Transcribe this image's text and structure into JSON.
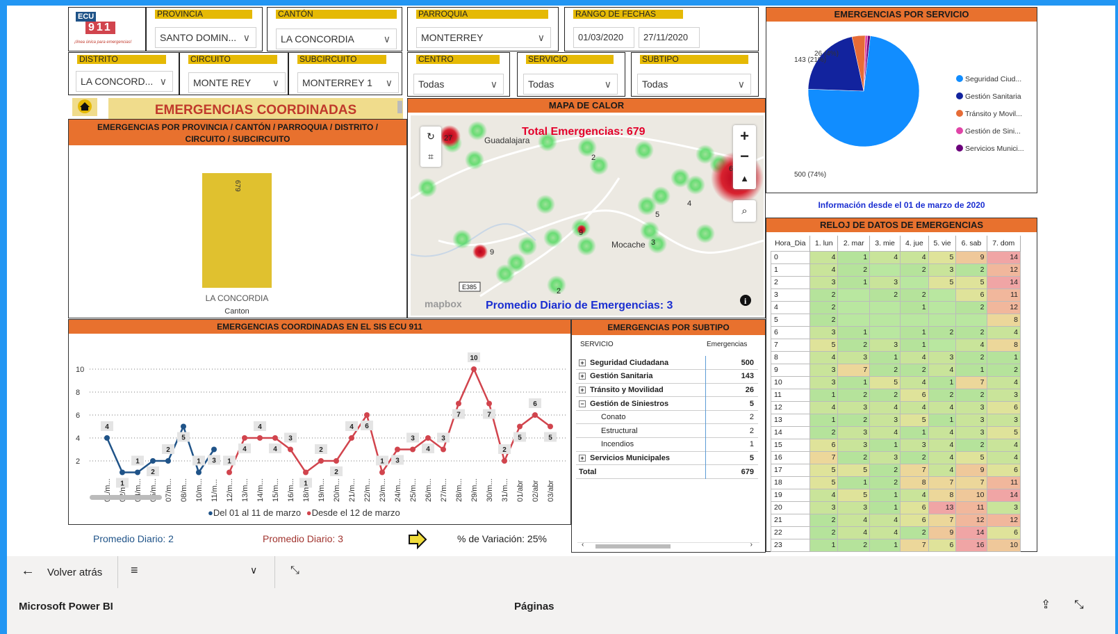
{
  "logo": {
    "main": "ECU",
    "number": "911",
    "tag": "¡línea única para emergencias!"
  },
  "slicers": {
    "provincia": {
      "label": "PROVINCIA",
      "value": "SANTO DOMIN..."
    },
    "canton": {
      "label": "CANTÓN",
      "value": "LA CONCORDIA"
    },
    "parroquia": {
      "label": "PARROQUIA",
      "value": "MONTERREY"
    },
    "rango": {
      "label": "RANGO DE FECHAS",
      "from": "01/03/2020",
      "to": "27/11/2020"
    },
    "distrito": {
      "label": "DISTRITO",
      "value": "LA CONCORD..."
    },
    "circuito": {
      "label": "CIRCUITO",
      "value": "MONTE REY"
    },
    "subcircuito": {
      "label": "SUBCIRCUITO",
      "value": "MONTERREY 1"
    },
    "centro": {
      "label": "CENTRO",
      "value": "Todas"
    },
    "servicio": {
      "label": "SERVICIO",
      "value": "Todas"
    },
    "subtipo": {
      "label": "SUBTIPO",
      "value": "Todas"
    }
  },
  "page_title": "EMERGENCIAS COORDINADAS",
  "bar_panel": {
    "title": "EMERGENCIAS POR PROVINCIA / CANTÓN / PARROQUIA / DISTRITO / CIRCUITO / SUBCIRCUITO",
    "xlabel": "Canton"
  },
  "map": {
    "title": "MAPA DE CALOR",
    "total": "Total Emergencias: 679",
    "avg": "Promedio Diario de Emergencias: 3",
    "places": [
      "Guadalajara",
      "Mocache"
    ],
    "road": "E385",
    "brand": "mapbox",
    "cluster_labels": [
      "27",
      "2",
      "4",
      "5",
      "9",
      "9",
      "3",
      "2",
      "6"
    ]
  },
  "service_panel": {
    "title": "EMERGENCIAS POR SERVICIO",
    "info": "Información desde el 01 de marzo de 2020"
  },
  "line_panel": {
    "title": "EMERGENCIAS COORDINADAS EN EL SIS ECU 911",
    "legend": [
      "Del 01 al 11 de marzo",
      "Desde el 12 de marzo"
    ],
    "avg1": "Promedio Diario: 2",
    "avg2": "Promedio Diario: 3",
    "variation": "% de Variación: 25%"
  },
  "subtipo_panel": {
    "title": "EMERGENCIAS POR SUBTIPO",
    "headers": [
      "SERVICIO",
      "Emergencias"
    ],
    "rows": [
      {
        "name": "Seguridad Ciudadana",
        "value": "500",
        "level": 0,
        "exp": "+"
      },
      {
        "name": "Gestión Sanitaria",
        "value": "143",
        "level": 0,
        "exp": "+"
      },
      {
        "name": "Tránsito y Movilidad",
        "value": "26",
        "level": 0,
        "exp": "+"
      },
      {
        "name": "Gestión de Siniestros",
        "value": "5",
        "level": 0,
        "exp": "−"
      },
      {
        "name": "Conato",
        "value": "2",
        "level": 1,
        "exp": ""
      },
      {
        "name": "Estructural",
        "value": "2",
        "level": 1,
        "exp": ""
      },
      {
        "name": "Incendios",
        "value": "1",
        "level": 1,
        "exp": ""
      },
      {
        "name": "Servicios Municipales",
        "value": "5",
        "level": 0,
        "exp": "+"
      },
      {
        "name": "Total",
        "value": "679",
        "level": 0,
        "exp": ""
      }
    ]
  },
  "reloj": {
    "title": "RELOJ DE DATOS DE EMERGENCIAS",
    "headers": [
      "Hora_Dia",
      "1. lun",
      "2. mar",
      "3. mie",
      "4. jue",
      "5. vie",
      "6. sab",
      "7. dom"
    ],
    "hours": [
      "0",
      "1",
      "2",
      "3",
      "4",
      "5",
      "6",
      "7",
      "8",
      "9",
      "10",
      "11",
      "12",
      "13",
      "14",
      "15",
      "16",
      "17",
      "18",
      "19",
      "20",
      "21",
      "22",
      "23"
    ],
    "values": [
      [
        4,
        1,
        4,
        4,
        5,
        9,
        14
      ],
      [
        4,
        2,
        null,
        2,
        3,
        2,
        12
      ],
      [
        3,
        1,
        3,
        null,
        5,
        5,
        14
      ],
      [
        2,
        null,
        2,
        2,
        null,
        6,
        11
      ],
      [
        2,
        null,
        null,
        1,
        null,
        2,
        12
      ],
      [
        2,
        null,
        null,
        null,
        null,
        null,
        8
      ],
      [
        3,
        1,
        null,
        1,
        2,
        2,
        4
      ],
      [
        5,
        2,
        3,
        1,
        null,
        4,
        8
      ],
      [
        4,
        3,
        1,
        4,
        3,
        2,
        1
      ],
      [
        3,
        7,
        2,
        2,
        4,
        1,
        2
      ],
      [
        3,
        1,
        5,
        4,
        1,
        7,
        4
      ],
      [
        1,
        2,
        2,
        6,
        2,
        2,
        3
      ],
      [
        4,
        3,
        4,
        4,
        4,
        3,
        6
      ],
      [
        1,
        2,
        3,
        5,
        1,
        3,
        3
      ],
      [
        2,
        3,
        4,
        1,
        4,
        3,
        5
      ],
      [
        6,
        3,
        1,
        3,
        4,
        2,
        4
      ],
      [
        7,
        2,
        3,
        2,
        4,
        5,
        4
      ],
      [
        5,
        5,
        2,
        7,
        4,
        9,
        6
      ],
      [
        5,
        1,
        2,
        8,
        7,
        7,
        11
      ],
      [
        4,
        5,
        1,
        4,
        8,
        10,
        14
      ],
      [
        3,
        3,
        1,
        6,
        13,
        11,
        3
      ],
      [
        2,
        4,
        4,
        6,
        7,
        12,
        12
      ],
      [
        2,
        4,
        4,
        2,
        9,
        14,
        6
      ],
      [
        1,
        2,
        1,
        7,
        6,
        16,
        10
      ]
    ]
  },
  "footer": {
    "back": "Volver atrás",
    "app": "Microsoft Power BI",
    "pages": "Páginas"
  },
  "colors": {
    "accent": "#e8712e",
    "yellow": "#e5b904",
    "blue": "#1f5388",
    "red": "#d1444d"
  },
  "chart_data": [
    {
      "type": "bar",
      "categories": [
        "LA CONCORDIA"
      ],
      "values": [
        679
      ],
      "xlabel": "Canton",
      "color": "#e0c12f"
    },
    {
      "type": "pie",
      "categories": [
        "Seguridad Ciud...",
        "Gestión Sanitaria",
        "Tránsito y Movil...",
        "Gestión de Sini...",
        "Servicios Munici..."
      ],
      "values": [
        500,
        143,
        26,
        5,
        5
      ],
      "labels": [
        "500 (74%)",
        "143 (21%)",
        "26 (4%)"
      ],
      "colors": [
        "#118dff",
        "#12239e",
        "#e66c37",
        "#e044a7",
        "#6b007b"
      ],
      "legend": "right"
    },
    {
      "type": "line",
      "x": [
        "01/m...",
        "02/m...",
        "04/m...",
        "05/m...",
        "07/m...",
        "08/m...",
        "10/m...",
        "11/m...",
        "12/m...",
        "13/m...",
        "14/m...",
        "15/m...",
        "16/m...",
        "18/m...",
        "19/m...",
        "20/m...",
        "21/m...",
        "22/m...",
        "23/m...",
        "24/m...",
        "25/m...",
        "26/m...",
        "27/m...",
        "28/m...",
        "29/m...",
        "30/m...",
        "31/m...",
        "01/abr",
        "02/abr",
        "03/abr"
      ],
      "series": [
        {
          "name": "Del 01 al 11 de marzo",
          "color": "#1f5388",
          "values": [
            4,
            1,
            1,
            2,
            2,
            5,
            1,
            3,
            null,
            null,
            null,
            null,
            null,
            null,
            null,
            null,
            null,
            null,
            null,
            null,
            null,
            null,
            null,
            null,
            null,
            null,
            null,
            null,
            null,
            null
          ]
        },
        {
          "name": "Desde el 12 de marzo",
          "color": "#d1444d",
          "values": [
            null,
            null,
            null,
            null,
            null,
            null,
            null,
            null,
            1,
            4,
            4,
            4,
            3,
            1,
            2,
            2,
            4,
            6,
            1,
            3,
            3,
            4,
            3,
            7,
            10,
            7,
            2,
            5,
            6,
            5
          ]
        }
      ],
      "ylim": [
        0,
        10
      ],
      "yticks": [
        2,
        4,
        6,
        8,
        10
      ],
      "grid": true
    }
  ]
}
